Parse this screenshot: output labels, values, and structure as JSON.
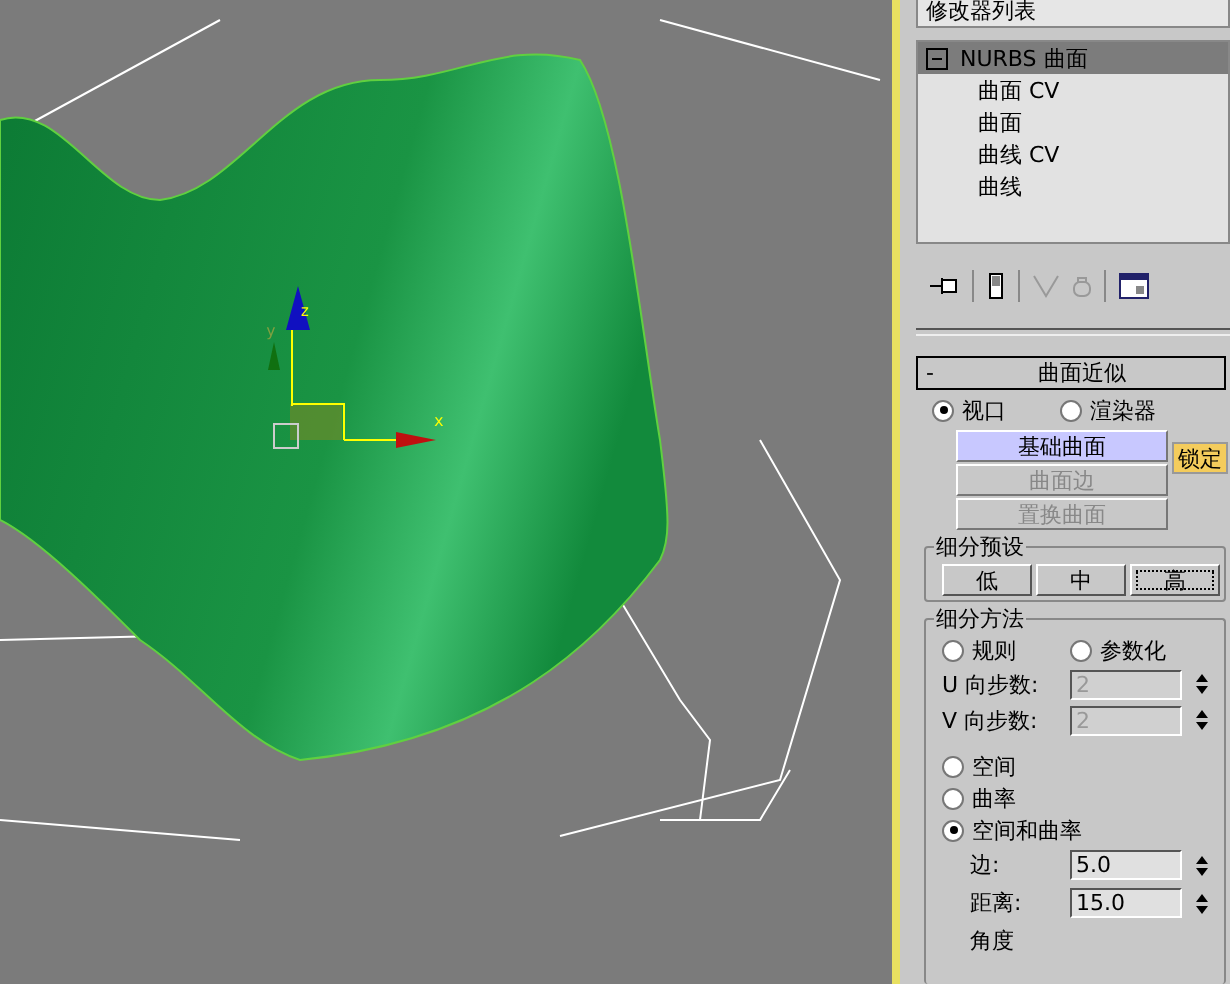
{
  "viewport": {
    "gizmo_axes": [
      {
        "kind": "x",
        "label": "x"
      },
      {
        "kind": "y",
        "label": "y"
      },
      {
        "kind": "z",
        "label": "z"
      }
    ]
  },
  "modifier_list": {
    "label": "修改器列表"
  },
  "stack": {
    "items": [
      {
        "label": "NURBS 曲面",
        "selected": true,
        "expanded": true,
        "children": [
          {
            "label": "曲面 CV",
            "selected": false
          },
          {
            "label": "曲面",
            "selected": false
          },
          {
            "label": "曲线 CV",
            "selected": false
          },
          {
            "label": "曲线",
            "selected": false
          }
        ]
      }
    ]
  },
  "stack_tools": [
    {
      "kind": "pin",
      "disabled": false
    },
    {
      "kind": "bar",
      "disabled": false
    },
    {
      "kind": "unique",
      "disabled": true
    },
    {
      "kind": "remove",
      "disabled": true
    },
    {
      "kind": "config",
      "disabled": false
    }
  ],
  "rollout": {
    "toggle": "-",
    "title": "曲面近似",
    "target_radios": [
      {
        "label": "视口",
        "selected": true
      },
      {
        "label": "渲染器",
        "selected": false
      }
    ],
    "surface_buttons": [
      {
        "label": "基础曲面",
        "selected": true,
        "disabled": false
      },
      {
        "label": "曲面边",
        "selected": false,
        "disabled": true
      },
      {
        "label": "置换曲面",
        "selected": false,
        "disabled": true
      }
    ],
    "lock_button": {
      "label": "锁定",
      "on": true
    },
    "presets": {
      "title": "细分预设",
      "buttons": [
        {
          "label": "低",
          "selected": false
        },
        {
          "label": "中",
          "selected": false
        },
        {
          "label": "高",
          "selected": true
        }
      ]
    },
    "method": {
      "title": "细分方法",
      "type_radios": [
        {
          "label": "规则",
          "selected": false
        },
        {
          "label": "参数化",
          "selected": false
        }
      ],
      "steps": [
        {
          "label": "U 向步数:",
          "value": "2",
          "disabled": true
        },
        {
          "label": "V 向步数:",
          "value": "2",
          "disabled": true
        }
      ],
      "mode_radios": [
        {
          "label": "空间",
          "selected": false
        },
        {
          "label": "曲率",
          "selected": false
        },
        {
          "label": "空间和曲率",
          "selected": true
        }
      ],
      "params": [
        {
          "label": "边:",
          "value": "5.0"
        },
        {
          "label": "距离:",
          "value": "15.0"
        },
        {
          "label": "角度"
        }
      ]
    }
  }
}
